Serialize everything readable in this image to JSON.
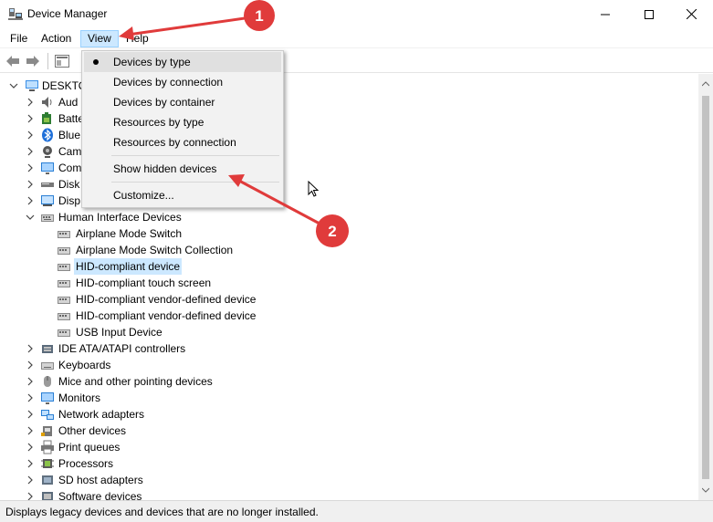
{
  "window": {
    "title": "Device Manager",
    "controls": {
      "minimize": "minimize-icon",
      "maximize": "maximize-icon",
      "close": "close-icon"
    }
  },
  "menu": [
    "File",
    "Action",
    "View",
    "Help"
  ],
  "dropdown": {
    "items": [
      {
        "label": "Devices by type",
        "checked": true
      },
      {
        "label": "Devices by connection",
        "checked": false
      },
      {
        "label": "Devices by container",
        "checked": false
      },
      {
        "label": "Resources by type",
        "checked": false
      },
      {
        "label": "Resources by connection",
        "checked": false
      },
      {
        "label": "Show hidden devices",
        "checked": false
      },
      {
        "label": "Customize...",
        "checked": false
      }
    ]
  },
  "tree": {
    "root": "DESKTO",
    "categories_partial": [
      "Aud",
      "Batte",
      "Blue",
      "Cam",
      "Com",
      "Disk",
      "Disp"
    ],
    "hid": {
      "label": "Human Interface Devices",
      "children": [
        "Airplane Mode Switch",
        "Airplane Mode Switch Collection",
        "HID-compliant device",
        "HID-compliant touch screen",
        "HID-compliant vendor-defined device",
        "HID-compliant vendor-defined device",
        "USB Input Device"
      ],
      "selected": "HID-compliant device"
    },
    "categories": [
      "IDE ATA/ATAPI controllers",
      "Keyboards",
      "Mice and other pointing devices",
      "Monitors",
      "Network adapters",
      "Other devices",
      "Print queues",
      "Processors",
      "SD host adapters",
      "Software devices"
    ]
  },
  "status": "Displays legacy devices and devices that are no longer installed.",
  "annotations": {
    "badge1": "1",
    "badge2": "2",
    "color": "#e03b3b"
  }
}
